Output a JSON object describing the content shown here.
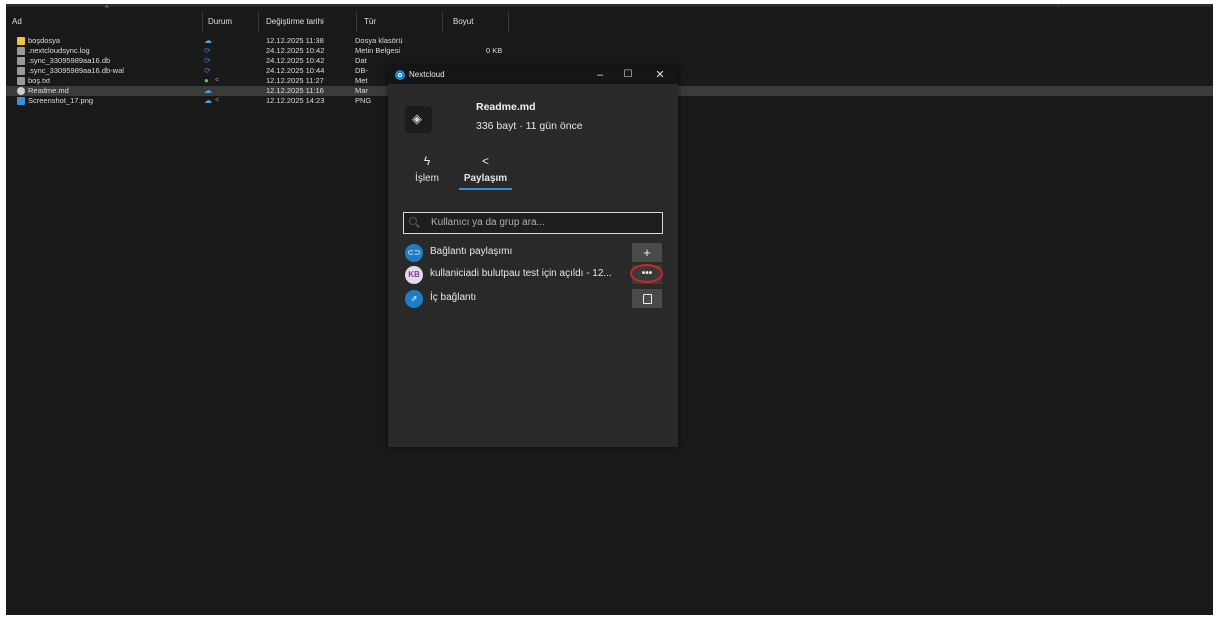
{
  "explorer": {
    "columns": {
      "name": "Ad",
      "status": "Durum",
      "modified": "Değiştirme tarihi",
      "type": "Tür",
      "size": "Boyut"
    },
    "files": [
      {
        "name": "boşdosya",
        "icon": "folder-icon",
        "status": "cloud",
        "modified": "12.12.2025 11:38",
        "type": "Dosya klasörü",
        "size": ""
      },
      {
        "name": ".nextcloudsync.log",
        "icon": "document-icon",
        "status": "sync",
        "modified": "24.12.2025 10:42",
        "type": "Metin Belgesi",
        "size": "0 KB"
      },
      {
        "name": ".sync_33095989aa16.db",
        "icon": "document-icon",
        "status": "sync",
        "modified": "24.12.2025 10:42",
        "type": "Dat",
        "size": ""
      },
      {
        "name": ".sync_33095989aa16.db-wal",
        "icon": "document-icon",
        "status": "sync",
        "modified": "24.12.2025 10:44",
        "type": "DB-",
        "size": ""
      },
      {
        "name": "boş.txt",
        "icon": "document-icon",
        "status": "ok",
        "modified": "12.12.2025 11:27",
        "type": "Met",
        "size": ""
      },
      {
        "name": "Readme.md",
        "icon": "markdown-icon",
        "status": "cloud",
        "modified": "12.12.2025 11:16",
        "type": "Mar",
        "size": ""
      },
      {
        "name": "Screenshot_17.png",
        "icon": "image-icon",
        "status": "cloud",
        "modified": "12.12.2025 14:23",
        "type": "PNG",
        "size": ""
      }
    ]
  },
  "nextcloud": {
    "window_title": "Nextcloud",
    "file_name": "Readme.md",
    "file_meta": "336 bayt · 11 gün önce",
    "tabs": [
      {
        "label": "İşlem",
        "icon": "activity-icon"
      },
      {
        "label": "Paylaşım",
        "icon": "share-icon"
      }
    ],
    "search_placeholder": "Kullanıcı ya da grup ara...",
    "shares": [
      {
        "avatar": "",
        "icon": "link-icon",
        "label": "Bağlantı paylaşımı",
        "action": "+"
      },
      {
        "avatar": "KB",
        "icon": "",
        "label": "kullaniciadi bulutpau test için açıldı - 12...",
        "action": "•••"
      },
      {
        "avatar": "",
        "icon": "internal-link-icon",
        "label": "İç bağlantı",
        "action": "copy"
      }
    ],
    "colors": {
      "accent": "#3c8fe0",
      "highlight": "#d4222a"
    }
  }
}
